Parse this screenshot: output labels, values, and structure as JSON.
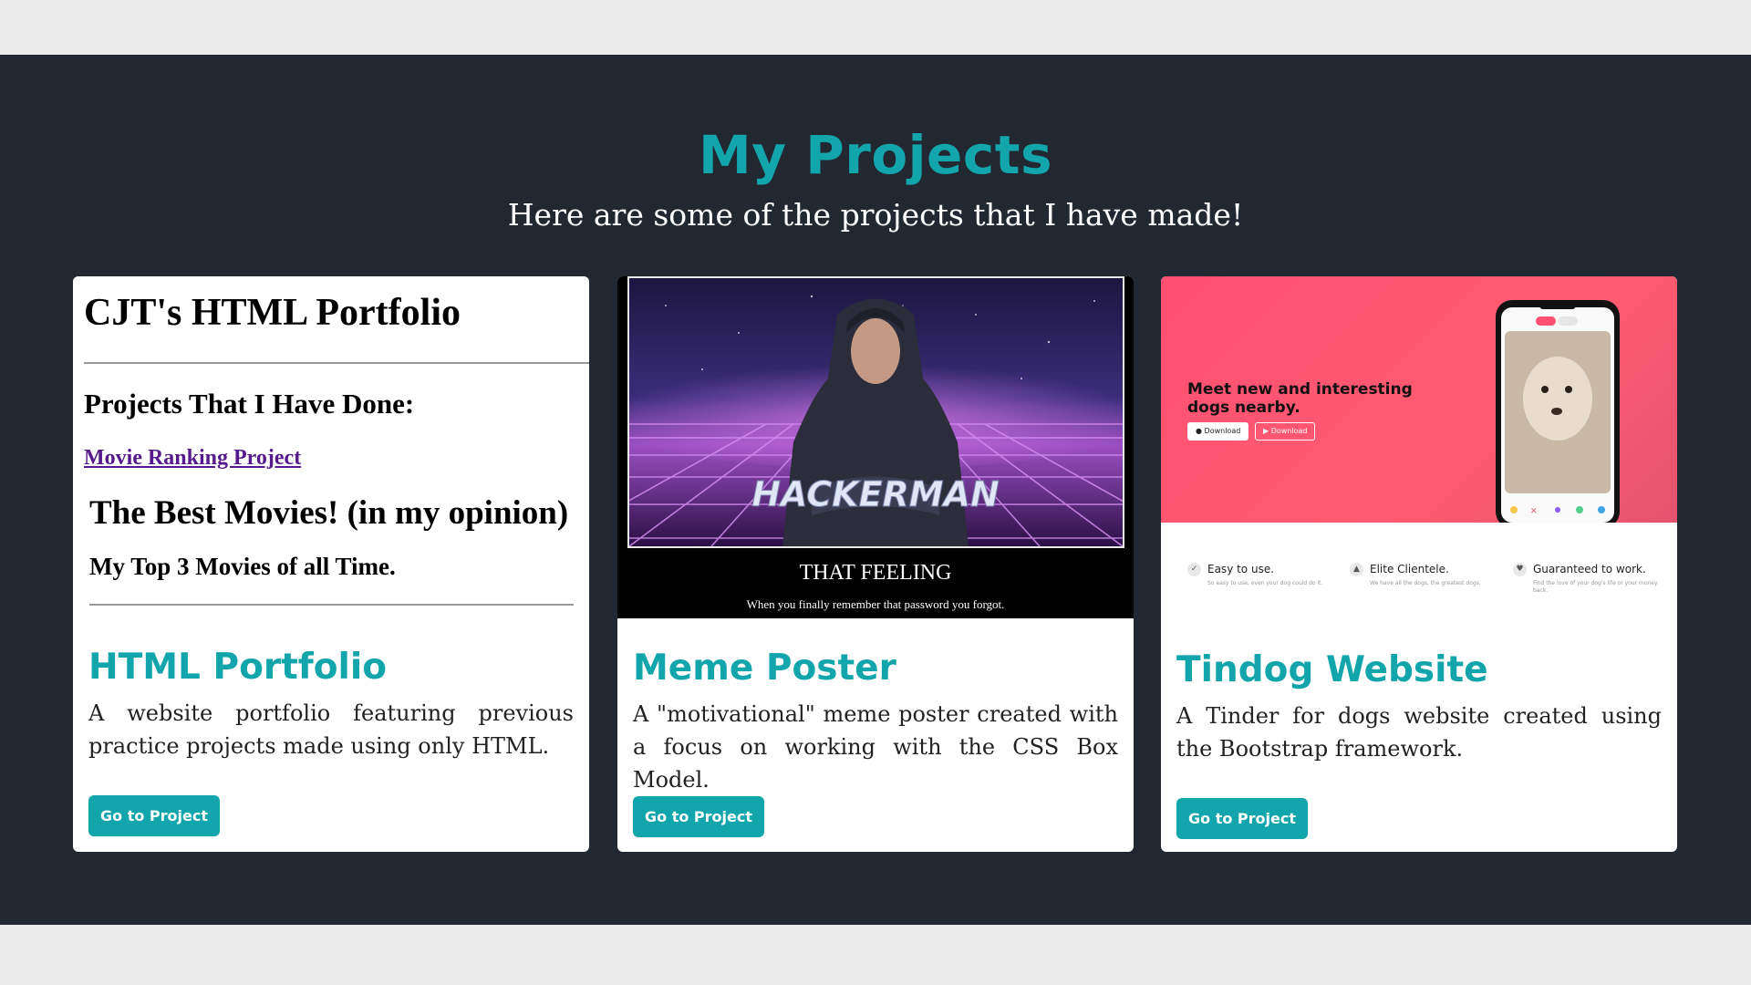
{
  "section": {
    "title": "My Projects",
    "subtitle": "Here are some of the projects that I have made!"
  },
  "colors": {
    "accent": "#12a5ab",
    "band": "#222832",
    "page": "#ececec"
  },
  "cards": [
    {
      "title": "HTML Portfolio",
      "text": "A website portfolio featuring previous practice projects made using only HTML.",
      "button": "Go to Project",
      "thumbnail": {
        "heading": "CJT's HTML Portfolio",
        "subheading": "Projects That I Have Done:",
        "link": "Movie Ranking Project",
        "page_heading": "The Best Movies! (in my opinion)",
        "page_subheading": "My Top 3 Movies of all Time."
      }
    },
    {
      "title": "Meme Poster",
      "text": "A \"motivational\" meme poster created with a focus on working with the CSS Box Model.",
      "button": "Go to Project",
      "thumbnail": {
        "overlay_text": "HACKERMAN",
        "caption": "THAT FEELING",
        "subcaption": "When you finally remember that password you forgot."
      }
    },
    {
      "title": "Tindog Website",
      "text": "A Tinder for dogs website created using the Bootstrap framework.",
      "button": "Go to Project",
      "thumbnail": {
        "hero_text": "Meet new and interesting dogs nearby.",
        "download_1": "Download",
        "download_2": "Download",
        "features": [
          {
            "title": "Easy to use.",
            "desc": "So easy to use, even your dog could do it."
          },
          {
            "title": "Elite Clientele.",
            "desc": "We have all the dogs, the greatest dogs."
          },
          {
            "title": "Guaranteed to work.",
            "desc": "Find the love of your dog's life or your money back."
          }
        ]
      }
    }
  ]
}
